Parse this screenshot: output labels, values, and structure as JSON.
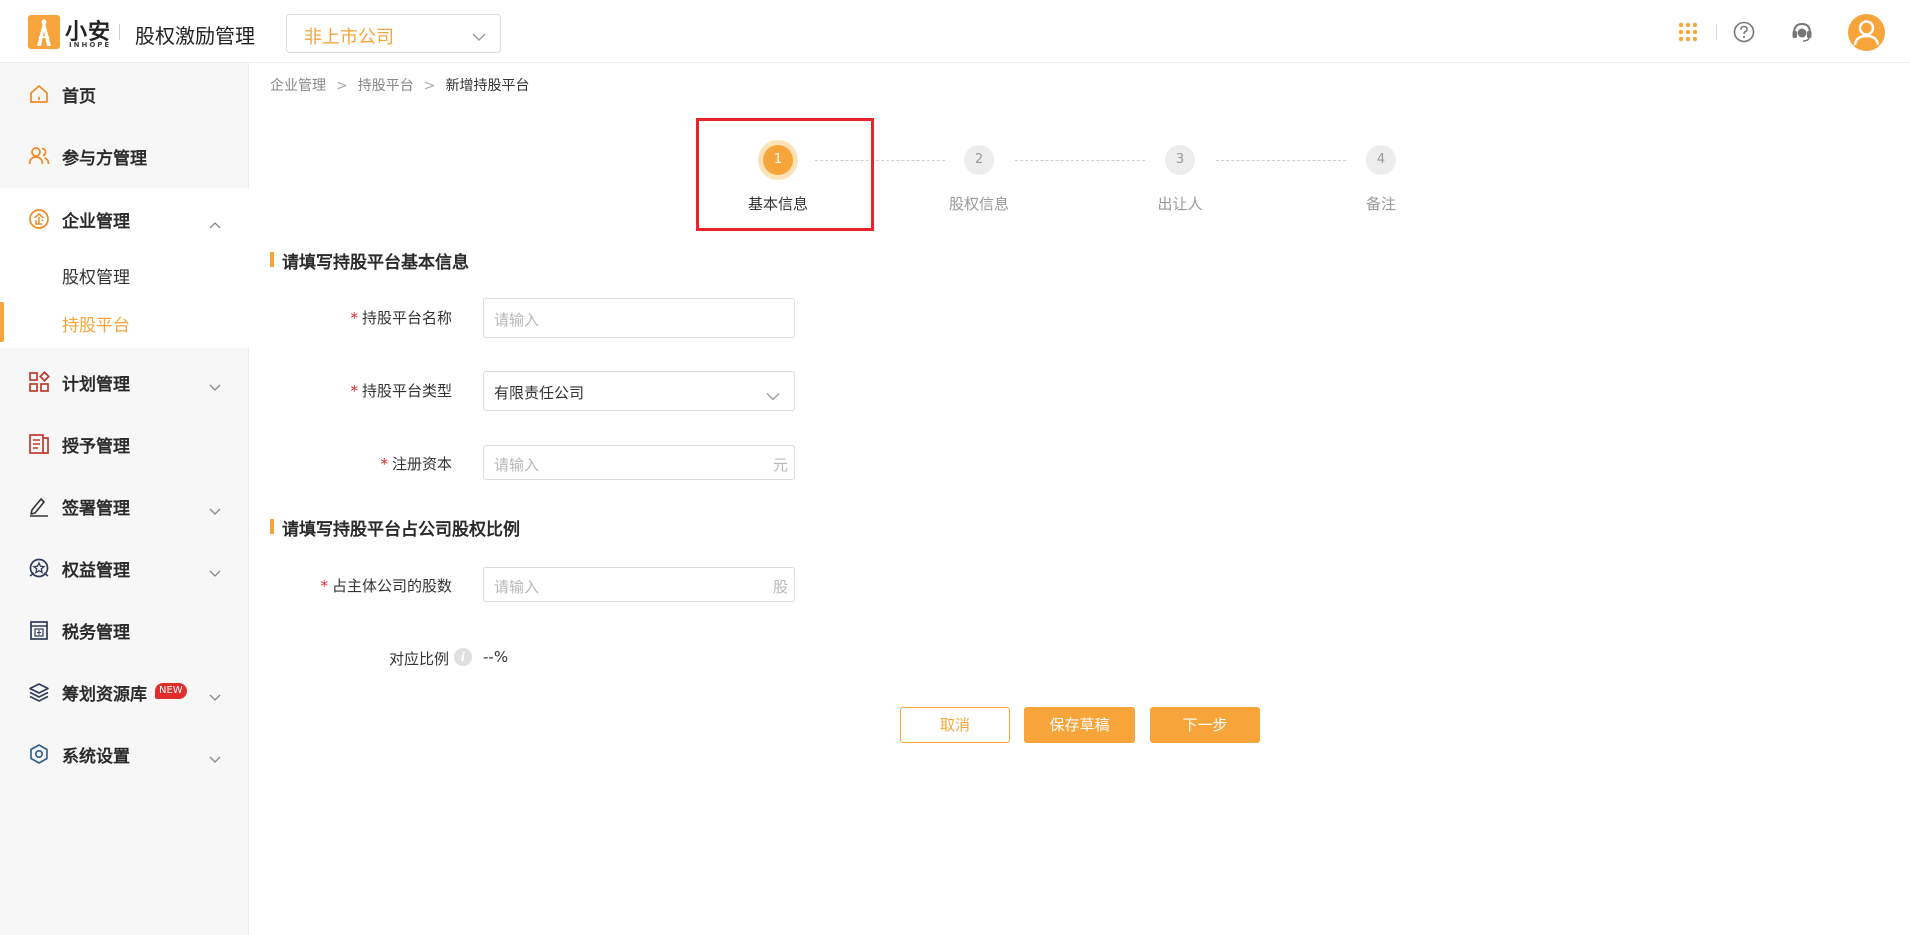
{
  "header": {
    "logo_text": "小安",
    "logo_sub": "INHOPE",
    "app_title": "股权激励管理",
    "company_select": "非上市公司",
    "accent_color": "#f7a53a"
  },
  "sidebar": {
    "items": [
      {
        "label": "首页",
        "icon": "home-icon"
      },
      {
        "label": "参与方管理",
        "icon": "users-icon"
      },
      {
        "label": "企业管理",
        "icon": "enterprise-icon",
        "expanded": true,
        "children": [
          {
            "label": "股权管理"
          },
          {
            "label": "持股平台",
            "active": true
          }
        ]
      },
      {
        "label": "计划管理",
        "icon": "plan-icon"
      },
      {
        "label": "授予管理",
        "icon": "grant-icon"
      },
      {
        "label": "签署管理",
        "icon": "sign-icon"
      },
      {
        "label": "权益管理",
        "icon": "equity-icon"
      },
      {
        "label": "税务管理",
        "icon": "tax-icon"
      },
      {
        "label": "筹划资源库",
        "icon": "layers-icon",
        "badge": "NEW"
      },
      {
        "label": "系统设置",
        "icon": "settings-icon"
      }
    ]
  },
  "breadcrumb": [
    "企业管理",
    "持股平台",
    "新增持股平台"
  ],
  "steps": [
    {
      "num": "1",
      "label": "基本信息",
      "active": true
    },
    {
      "num": "2",
      "label": "股权信息"
    },
    {
      "num": "3",
      "label": "出让人"
    },
    {
      "num": "4",
      "label": "备注"
    }
  ],
  "form": {
    "section1_title": "请填写持股平台基本信息",
    "name_label": "持股平台名称",
    "name_placeholder": "请输入",
    "type_label": "持股平台类型",
    "type_value": "有限责任公司",
    "capital_label": "注册资本",
    "capital_placeholder": "请输入",
    "capital_suffix": "元",
    "section2_title": "请填写持股平台占公司股权比例",
    "shares_label": "占主体公司的股数",
    "shares_placeholder": "请输入",
    "shares_suffix": "股",
    "ratio_label": "对应比例",
    "ratio_value": "--%",
    "required_mark": "*"
  },
  "actions": {
    "cancel": "取消",
    "save_draft": "保存草稿",
    "next": "下一步"
  }
}
